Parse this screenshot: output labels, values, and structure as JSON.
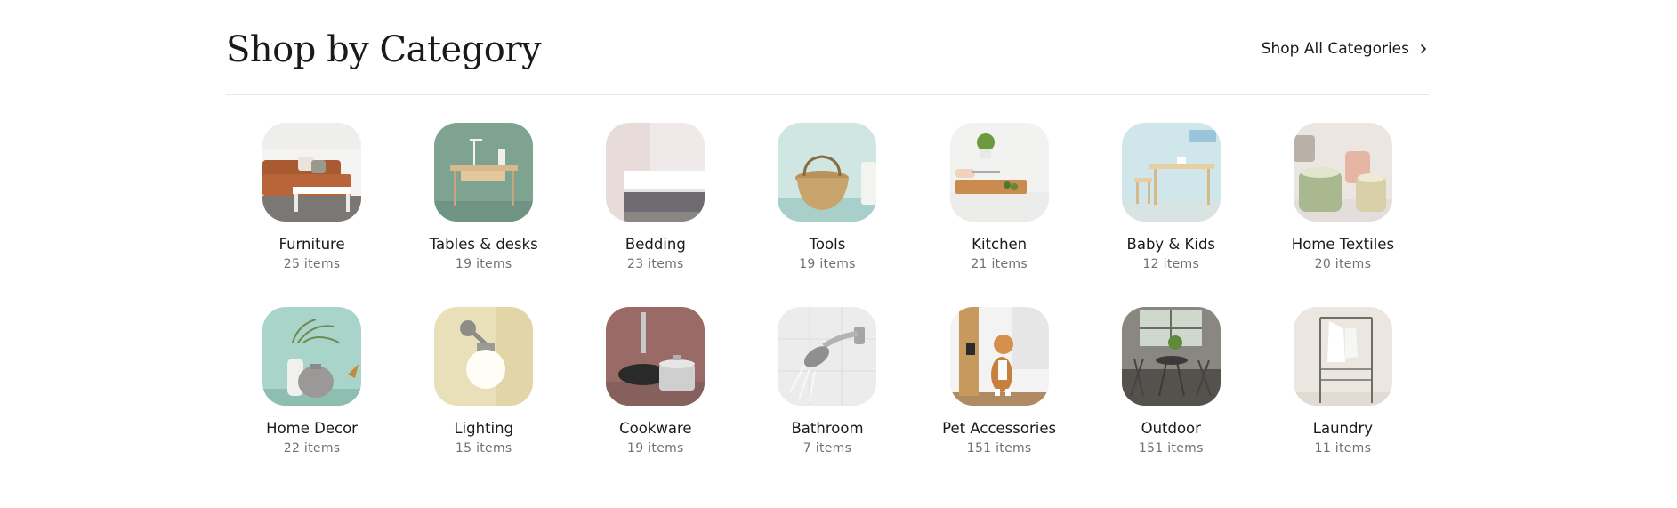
{
  "header": {
    "title": "Shop by Category",
    "shop_all_label": "Shop All Categories",
    "chevron_icon": "chevron-right-icon"
  },
  "categories": [
    {
      "name": "Furniture",
      "count": "25 items",
      "image": "sofa-photo"
    },
    {
      "name": "Tables & desks",
      "count": "19 items",
      "image": "desk-photo"
    },
    {
      "name": "Bedding",
      "count": "23 items",
      "image": "mattress-photo"
    },
    {
      "name": "Tools",
      "count": "19 items",
      "image": "basket-photo"
    },
    {
      "name": "Kitchen",
      "count": "21 items",
      "image": "cutting-board-photo"
    },
    {
      "name": "Baby & Kids",
      "count": "12 items",
      "image": "kids-table-photo"
    },
    {
      "name": "Home Textiles",
      "count": "20 items",
      "image": "candles-photo"
    },
    {
      "name": "Home Decor",
      "count": "22 items",
      "image": "vases-photo"
    },
    {
      "name": "Lighting",
      "count": "15 items",
      "image": "wall-lamp-photo"
    },
    {
      "name": "Cookware",
      "count": "19 items",
      "image": "pans-photo"
    },
    {
      "name": "Bathroom",
      "count": "7 items",
      "image": "shower-head-photo"
    },
    {
      "name": "Pet Accessories",
      "count": "151 items",
      "image": "cat-scratcher-photo"
    },
    {
      "name": "Outdoor",
      "count": "151 items",
      "image": "patio-set-photo"
    },
    {
      "name": "Laundry",
      "count": "11 items",
      "image": "clothes-rack-photo"
    }
  ]
}
